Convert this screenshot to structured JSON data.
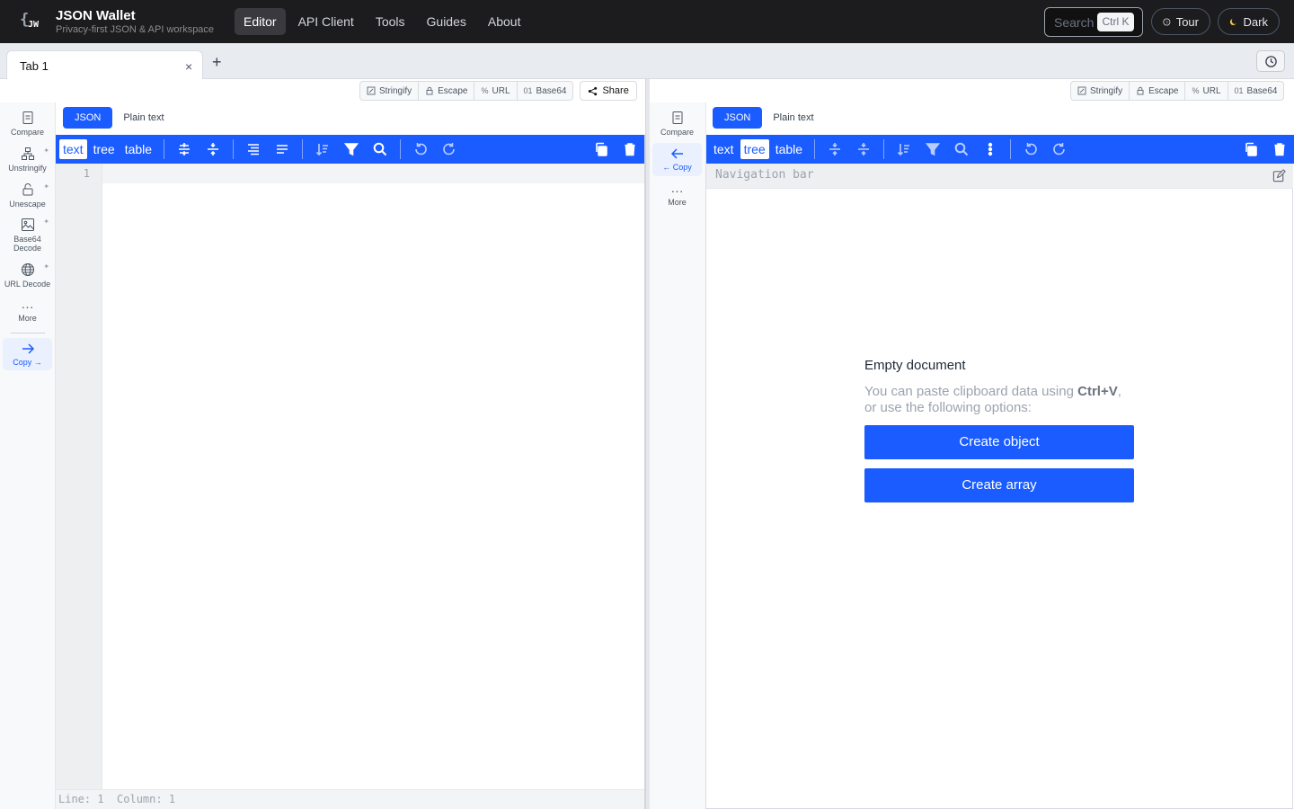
{
  "app": {
    "title": "JSON Wallet",
    "subtitle": "Privacy-first JSON & API workspace",
    "logo_text": "JW"
  },
  "nav": {
    "links": [
      "Editor",
      "API Client",
      "Tools",
      "Guides",
      "About"
    ],
    "active": "Editor"
  },
  "search": {
    "placeholder": "Search",
    "shortcut": "Ctrl K"
  },
  "top_buttons": {
    "tour": "Tour",
    "theme": "Dark"
  },
  "tabs": {
    "items": [
      {
        "label": "Tab 1"
      }
    ],
    "add_label": "+",
    "close_label": "×"
  },
  "left": {
    "transforms": [
      {
        "icon": "stringify-icon",
        "label": "Stringify"
      },
      {
        "icon": "lock-icon",
        "label": "Escape"
      },
      {
        "icon": "percent-icon",
        "label": "URL"
      },
      {
        "icon": "binary-icon",
        "label": "Base64"
      }
    ],
    "share_label": "Share",
    "sidebar": [
      {
        "icon": "compare-icon",
        "label": "Compare",
        "pinnable": false
      },
      {
        "icon": "unstringify-icon",
        "label": "Unstringify",
        "pinnable": true
      },
      {
        "icon": "unlock-icon",
        "label": "Unescape",
        "pinnable": true
      },
      {
        "icon": "image-icon",
        "label": "Base64 Decode",
        "pinnable": true
      },
      {
        "icon": "globe-icon",
        "label": "URL Decode",
        "pinnable": true
      },
      {
        "icon": "more-icon",
        "label": "More",
        "pinnable": false
      },
      {
        "icon": "arrow-right-icon",
        "label": "Copy →",
        "pinnable": false
      }
    ],
    "mode_tabs": [
      "JSON",
      "Plain text"
    ],
    "active_mode": "JSON",
    "view_tabs": [
      "text",
      "tree",
      "table"
    ],
    "active_view": "text",
    "line_numbers": [
      "1"
    ],
    "status": "Line: 1  Column: 1"
  },
  "right": {
    "transforms": [
      {
        "icon": "stringify-icon",
        "label": "Stringify"
      },
      {
        "icon": "lock-icon",
        "label": "Escape"
      },
      {
        "icon": "percent-icon",
        "label": "URL"
      },
      {
        "icon": "binary-icon",
        "label": "Base64"
      }
    ],
    "sidebar": [
      {
        "icon": "compare-icon",
        "label": "Compare"
      },
      {
        "icon": "arrow-left-icon",
        "label": "← Copy"
      },
      {
        "icon": "more-icon",
        "label": "More"
      }
    ],
    "mode_tabs": [
      "JSON",
      "Plain text"
    ],
    "active_mode": "JSON",
    "view_tabs": [
      "text",
      "tree",
      "table"
    ],
    "active_view": "tree",
    "navbar_placeholder": "Navigation bar",
    "empty": {
      "title": "Empty document",
      "desc_before": "You can paste clipboard data using ",
      "desc_key": "Ctrl+V",
      "desc_after": ", or use the following options:",
      "create_object": "Create object",
      "create_array": "Create array"
    }
  },
  "colors": {
    "accent": "#1a5cff",
    "nav_bg": "#1c1c1e",
    "muted": "#9ca3af"
  }
}
